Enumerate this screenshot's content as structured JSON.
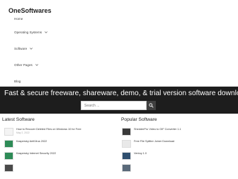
{
  "site": {
    "title": "OneSoftwares"
  },
  "nav": {
    "items": [
      {
        "label": "Home",
        "has_dropdown": false
      },
      {
        "label": "Operating Systems",
        "has_dropdown": true
      },
      {
        "label": "Software",
        "has_dropdown": true
      },
      {
        "label": "Other Pages",
        "has_dropdown": true
      },
      {
        "label": "Blog",
        "has_dropdown": false
      }
    ]
  },
  "hero": {
    "title": "Fast & secure freeware, shareware, demo, & trial version software download",
    "search_placeholder": "Search ...",
    "search_icon": "search-icon"
  },
  "latest": {
    "heading": "Latest Software",
    "posts": [
      {
        "title": "How to Recover Deleted Files on Windows 10 for Free",
        "date": "May 2, 2022"
      },
      {
        "title": "Kaspersky AntiVirus 2022",
        "date": ""
      },
      {
        "title": "Kaspersky Internet Security 2022",
        "date": ""
      },
      {
        "title": "",
        "date": ""
      }
    ]
  },
  "popular": {
    "heading": "Popular Software",
    "posts": [
      {
        "title": "ShedderPro Video to GIF Converter 1.1",
        "date": ""
      },
      {
        "title": "Free File Splitter Joiner Download",
        "date": ""
      },
      {
        "title": "Ventoy 1.0",
        "date": ""
      },
      {
        "title": "",
        "date": ""
      }
    ]
  },
  "colors": {
    "hero_bg": "#1d1d1d",
    "search_button": "#3f3f3f",
    "thumb_green": "#2e8b57",
    "thumb_dark": "#3a3a3a"
  }
}
